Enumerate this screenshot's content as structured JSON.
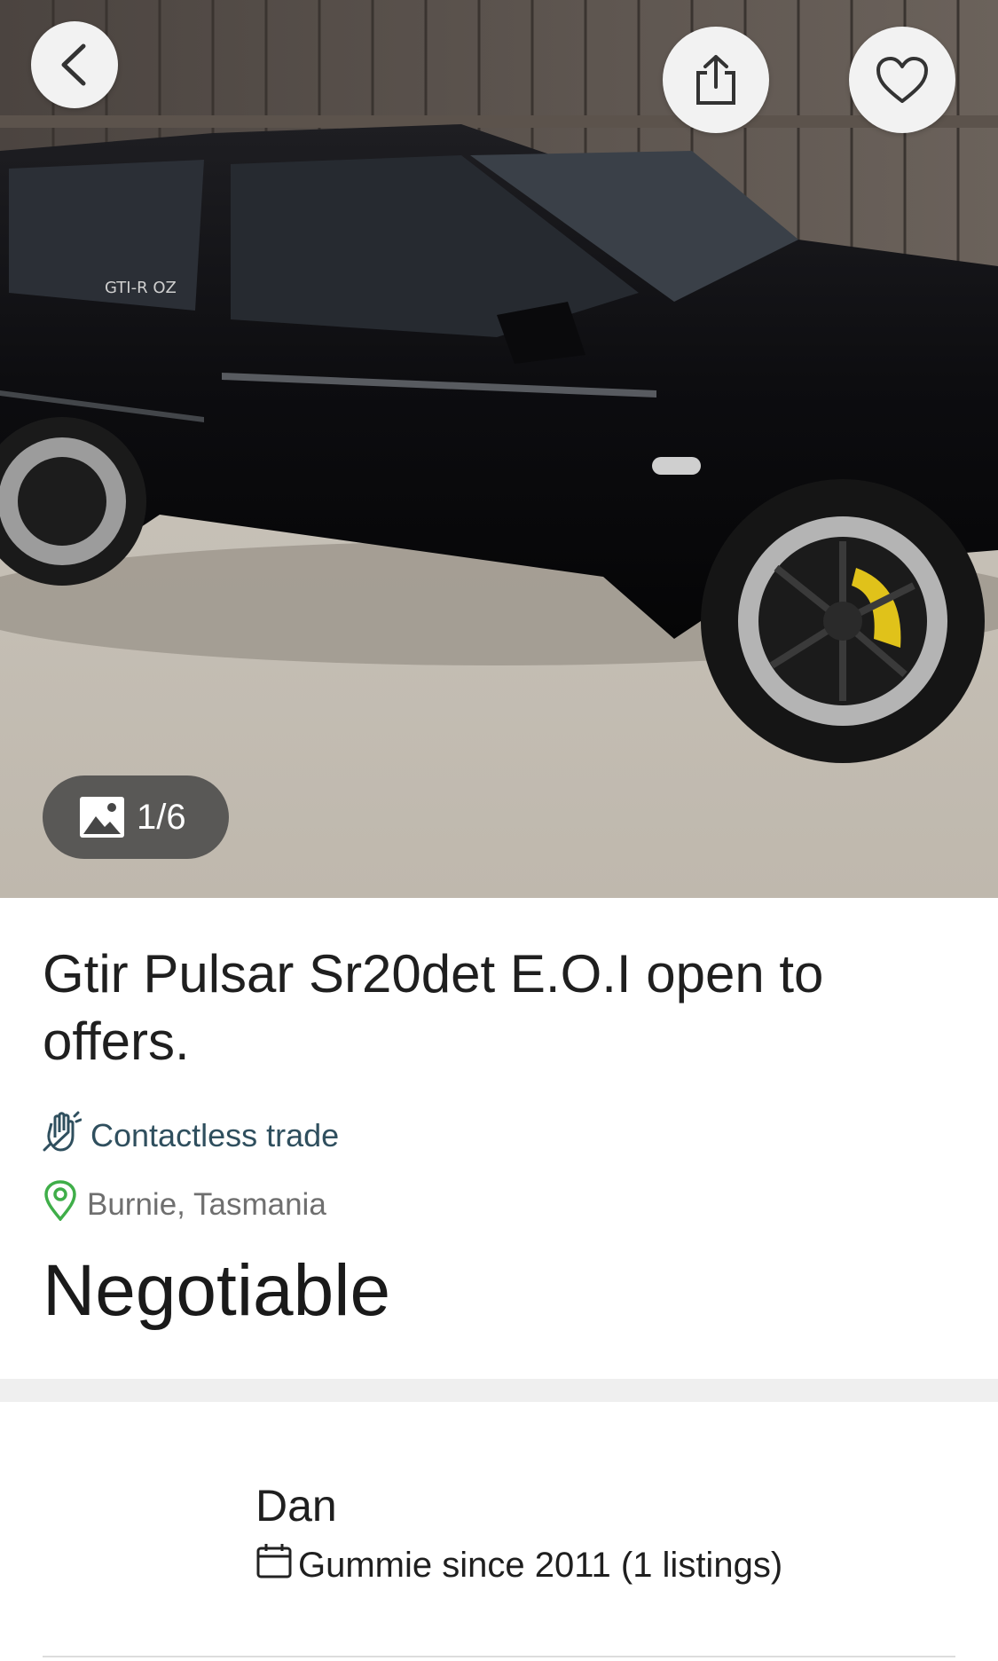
{
  "listing": {
    "image_counter": "1/6",
    "title": "Gtir Pulsar Sr20det E.O.I open to offers.",
    "contactless_label": "Contactless trade",
    "location": "Burnie, Tasmania",
    "price": "Negotiable"
  },
  "seller": {
    "name": "Dan",
    "member_info": "Gummie since 2011 (1 listings)"
  },
  "icons": {
    "back": "chevron-left-icon",
    "share": "share-icon",
    "favorite": "heart-icon",
    "gallery": "image-icon",
    "contactless": "hand-wave-icon",
    "location": "map-pin-icon",
    "calendar": "calendar-icon"
  },
  "colors": {
    "accent_text": "#2f4f5e",
    "location_pin": "#3fae49",
    "divider": "#efefef"
  }
}
